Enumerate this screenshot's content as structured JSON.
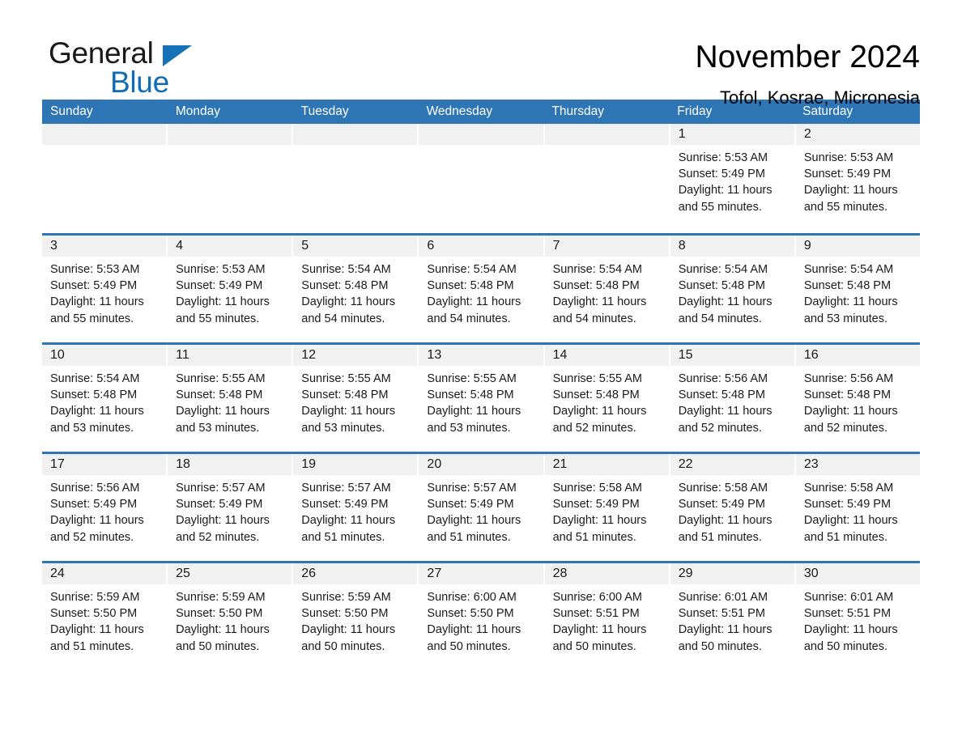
{
  "brand": {
    "name_part1": "General",
    "name_part2": "Blue",
    "triangle_color": "#1572b6",
    "blue_color": "#0f6cb6"
  },
  "header": {
    "title": "November 2024",
    "location": "Tofol, Kosrae, Micronesia"
  },
  "theme": {
    "header_bg": "#2e75b6",
    "header_text": "#ffffff",
    "daynum_band": "#f1f1f1",
    "body_text": "#1a1a1a",
    "page_bg": "#ffffff"
  },
  "calendar": {
    "weekday_headers": [
      "Sunday",
      "Monday",
      "Tuesday",
      "Wednesday",
      "Thursday",
      "Friday",
      "Saturday"
    ],
    "labels": {
      "sunrise": "Sunrise:",
      "sunset": "Sunset:",
      "daylight": "Daylight:"
    },
    "weeks": [
      [
        {
          "day": "",
          "lines": []
        },
        {
          "day": "",
          "lines": []
        },
        {
          "day": "",
          "lines": []
        },
        {
          "day": "",
          "lines": []
        },
        {
          "day": "",
          "lines": []
        },
        {
          "day": "1",
          "lines": [
            "Sunrise: 5:53 AM",
            "Sunset: 5:49 PM",
            "Daylight: 11 hours",
            "and 55 minutes."
          ]
        },
        {
          "day": "2",
          "lines": [
            "Sunrise: 5:53 AM",
            "Sunset: 5:49 PM",
            "Daylight: 11 hours",
            "and 55 minutes."
          ]
        }
      ],
      [
        {
          "day": "3",
          "lines": [
            "Sunrise: 5:53 AM",
            "Sunset: 5:49 PM",
            "Daylight: 11 hours",
            "and 55 minutes."
          ]
        },
        {
          "day": "4",
          "lines": [
            "Sunrise: 5:53 AM",
            "Sunset: 5:49 PM",
            "Daylight: 11 hours",
            "and 55 minutes."
          ]
        },
        {
          "day": "5",
          "lines": [
            "Sunrise: 5:54 AM",
            "Sunset: 5:48 PM",
            "Daylight: 11 hours",
            "and 54 minutes."
          ]
        },
        {
          "day": "6",
          "lines": [
            "Sunrise: 5:54 AM",
            "Sunset: 5:48 PM",
            "Daylight: 11 hours",
            "and 54 minutes."
          ]
        },
        {
          "day": "7",
          "lines": [
            "Sunrise: 5:54 AM",
            "Sunset: 5:48 PM",
            "Daylight: 11 hours",
            "and 54 minutes."
          ]
        },
        {
          "day": "8",
          "lines": [
            "Sunrise: 5:54 AM",
            "Sunset: 5:48 PM",
            "Daylight: 11 hours",
            "and 54 minutes."
          ]
        },
        {
          "day": "9",
          "lines": [
            "Sunrise: 5:54 AM",
            "Sunset: 5:48 PM",
            "Daylight: 11 hours",
            "and 53 minutes."
          ]
        }
      ],
      [
        {
          "day": "10",
          "lines": [
            "Sunrise: 5:54 AM",
            "Sunset: 5:48 PM",
            "Daylight: 11 hours",
            "and 53 minutes."
          ]
        },
        {
          "day": "11",
          "lines": [
            "Sunrise: 5:55 AM",
            "Sunset: 5:48 PM",
            "Daylight: 11 hours",
            "and 53 minutes."
          ]
        },
        {
          "day": "12",
          "lines": [
            "Sunrise: 5:55 AM",
            "Sunset: 5:48 PM",
            "Daylight: 11 hours",
            "and 53 minutes."
          ]
        },
        {
          "day": "13",
          "lines": [
            "Sunrise: 5:55 AM",
            "Sunset: 5:48 PM",
            "Daylight: 11 hours",
            "and 53 minutes."
          ]
        },
        {
          "day": "14",
          "lines": [
            "Sunrise: 5:55 AM",
            "Sunset: 5:48 PM",
            "Daylight: 11 hours",
            "and 52 minutes."
          ]
        },
        {
          "day": "15",
          "lines": [
            "Sunrise: 5:56 AM",
            "Sunset: 5:48 PM",
            "Daylight: 11 hours",
            "and 52 minutes."
          ]
        },
        {
          "day": "16",
          "lines": [
            "Sunrise: 5:56 AM",
            "Sunset: 5:48 PM",
            "Daylight: 11 hours",
            "and 52 minutes."
          ]
        }
      ],
      [
        {
          "day": "17",
          "lines": [
            "Sunrise: 5:56 AM",
            "Sunset: 5:49 PM",
            "Daylight: 11 hours",
            "and 52 minutes."
          ]
        },
        {
          "day": "18",
          "lines": [
            "Sunrise: 5:57 AM",
            "Sunset: 5:49 PM",
            "Daylight: 11 hours",
            "and 52 minutes."
          ]
        },
        {
          "day": "19",
          "lines": [
            "Sunrise: 5:57 AM",
            "Sunset: 5:49 PM",
            "Daylight: 11 hours",
            "and 51 minutes."
          ]
        },
        {
          "day": "20",
          "lines": [
            "Sunrise: 5:57 AM",
            "Sunset: 5:49 PM",
            "Daylight: 11 hours",
            "and 51 minutes."
          ]
        },
        {
          "day": "21",
          "lines": [
            "Sunrise: 5:58 AM",
            "Sunset: 5:49 PM",
            "Daylight: 11 hours",
            "and 51 minutes."
          ]
        },
        {
          "day": "22",
          "lines": [
            "Sunrise: 5:58 AM",
            "Sunset: 5:49 PM",
            "Daylight: 11 hours",
            "and 51 minutes."
          ]
        },
        {
          "day": "23",
          "lines": [
            "Sunrise: 5:58 AM",
            "Sunset: 5:49 PM",
            "Daylight: 11 hours",
            "and 51 minutes."
          ]
        }
      ],
      [
        {
          "day": "24",
          "lines": [
            "Sunrise: 5:59 AM",
            "Sunset: 5:50 PM",
            "Daylight: 11 hours",
            "and 51 minutes."
          ]
        },
        {
          "day": "25",
          "lines": [
            "Sunrise: 5:59 AM",
            "Sunset: 5:50 PM",
            "Daylight: 11 hours",
            "and 50 minutes."
          ]
        },
        {
          "day": "26",
          "lines": [
            "Sunrise: 5:59 AM",
            "Sunset: 5:50 PM",
            "Daylight: 11 hours",
            "and 50 minutes."
          ]
        },
        {
          "day": "27",
          "lines": [
            "Sunrise: 6:00 AM",
            "Sunset: 5:50 PM",
            "Daylight: 11 hours",
            "and 50 minutes."
          ]
        },
        {
          "day": "28",
          "lines": [
            "Sunrise: 6:00 AM",
            "Sunset: 5:51 PM",
            "Daylight: 11 hours",
            "and 50 minutes."
          ]
        },
        {
          "day": "29",
          "lines": [
            "Sunrise: 6:01 AM",
            "Sunset: 5:51 PM",
            "Daylight: 11 hours",
            "and 50 minutes."
          ]
        },
        {
          "day": "30",
          "lines": [
            "Sunrise: 6:01 AM",
            "Sunset: 5:51 PM",
            "Daylight: 11 hours",
            "and 50 minutes."
          ]
        }
      ]
    ]
  }
}
